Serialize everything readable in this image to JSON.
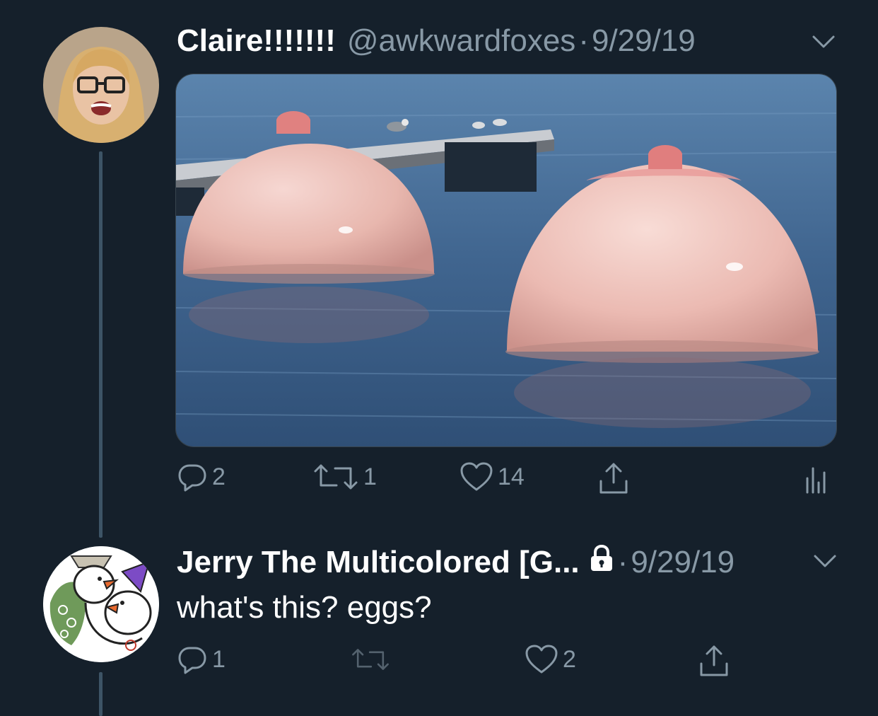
{
  "tweet1": {
    "name": "Claire!!!!!!!",
    "handle": "@awkwardfoxes",
    "separator": "·",
    "date": "9/29/19",
    "reply_count": "2",
    "retweet_count": "1",
    "like_count": "14"
  },
  "tweet2": {
    "name": "Jerry The Multicolored [G...",
    "separator": "·",
    "date": "9/29/19",
    "text": "what's this? eggs?",
    "reply_count": "1",
    "like_count": "2"
  },
  "colors": {
    "background": "#15202b",
    "secondary_text": "#8899a6",
    "thread_line": "#3d5466"
  },
  "icons": [
    "chevron-down-icon",
    "reply-icon",
    "retweet-icon",
    "like-icon",
    "share-icon",
    "analytics-icon",
    "lock-icon"
  ]
}
